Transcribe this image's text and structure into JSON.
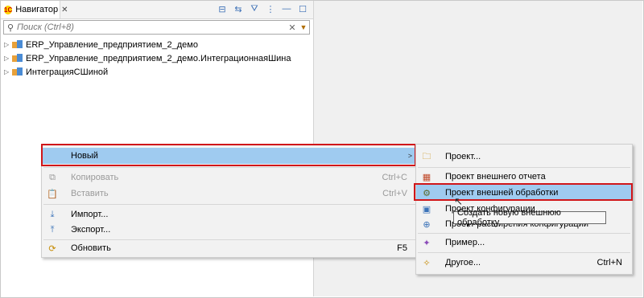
{
  "navigator": {
    "tab_title": "Навигатор",
    "search_placeholder": "Поиск (Ctrl+8)",
    "tree": [
      {
        "label": "ERP_Управление_предприятием_2_демо"
      },
      {
        "label": "ERP_Управление_предприятием_2_демо.ИнтеграционнаяШина"
      },
      {
        "label": "ИнтеграцияСШиной"
      }
    ]
  },
  "context_menu": {
    "items": [
      {
        "label": "Новый",
        "shortcut": "",
        "disabled": false,
        "selected": true,
        "has_submenu": true
      },
      {
        "label": "Копировать",
        "shortcut": "Ctrl+C",
        "disabled": true
      },
      {
        "label": "Вставить",
        "shortcut": "Ctrl+V",
        "disabled": true
      },
      {
        "label": "Импорт...",
        "shortcut": "",
        "disabled": false
      },
      {
        "label": "Экспорт...",
        "shortcut": "",
        "disabled": false
      },
      {
        "label": "Обновить",
        "shortcut": "F5",
        "disabled": false
      }
    ]
  },
  "submenu": {
    "items": [
      {
        "label": "Проект...",
        "shortcut": ""
      },
      {
        "label": "Проект внешнего отчета",
        "shortcut": ""
      },
      {
        "label": "Проект внешней обработки",
        "shortcut": "",
        "selected": true
      },
      {
        "label": "Проект конфигурации",
        "shortcut": ""
      },
      {
        "label": "Проект расширения конфигурации",
        "shortcut": ""
      },
      {
        "label": "Пример...",
        "shortcut": ""
      },
      {
        "label": "Другое...",
        "shortcut": "Ctrl+N"
      }
    ]
  },
  "tooltip": "Создать новую внешнюю обработку",
  "colors": {
    "selection": "#9fcbf0",
    "highlight_border": "#d0161a"
  }
}
